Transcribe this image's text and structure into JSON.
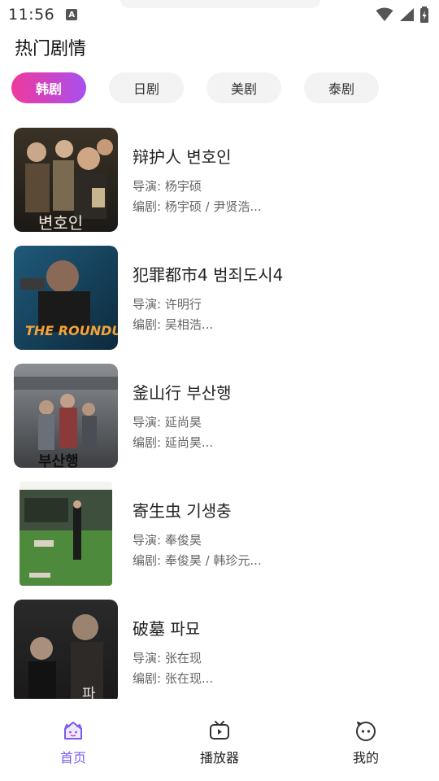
{
  "status_bar": {
    "time": "11:56",
    "a_icon": "A"
  },
  "header": {
    "title": "热门剧情"
  },
  "tabs": [
    {
      "label": "韩剧",
      "active": true
    },
    {
      "label": "日剧",
      "active": false
    },
    {
      "label": "美剧",
      "active": false
    },
    {
      "label": "泰剧",
      "active": false
    }
  ],
  "items": [
    {
      "title": "辩护人 변호인",
      "director": "导演: 杨宇硕",
      "writer": "编剧: 杨宇硕 / 尹贤浩...",
      "poster_text": "변호인"
    },
    {
      "title": "犯罪都市4 범죄도시4",
      "director": "导演: 许明行",
      "writer": "编剧: 吴相浩...",
      "poster_text": "THE ROUNDUP"
    },
    {
      "title": "釜山行 부산행",
      "director": "导演: 延尚昊",
      "writer": "编剧: 延尚昊...",
      "poster_text": "부산행"
    },
    {
      "title": "寄生虫 기생충",
      "director": "导演: 奉俊昊",
      "writer": "编剧: 奉俊昊 / 韩珍元...",
      "poster_text": ""
    },
    {
      "title": "破墓 파묘",
      "director": "导演: 张在现",
      "writer": "编剧: 张在现...",
      "poster_text": "파"
    }
  ],
  "bottom_nav": [
    {
      "label": "首页",
      "icon": "home-icon",
      "active": true
    },
    {
      "label": "播放器",
      "icon": "tv-icon",
      "active": false
    },
    {
      "label": "我的",
      "icon": "face-icon",
      "active": false
    }
  ],
  "colors": {
    "accent_start": "#ef3a9a",
    "accent_end": "#a84ff0",
    "nav_active": "#7a5af0"
  }
}
